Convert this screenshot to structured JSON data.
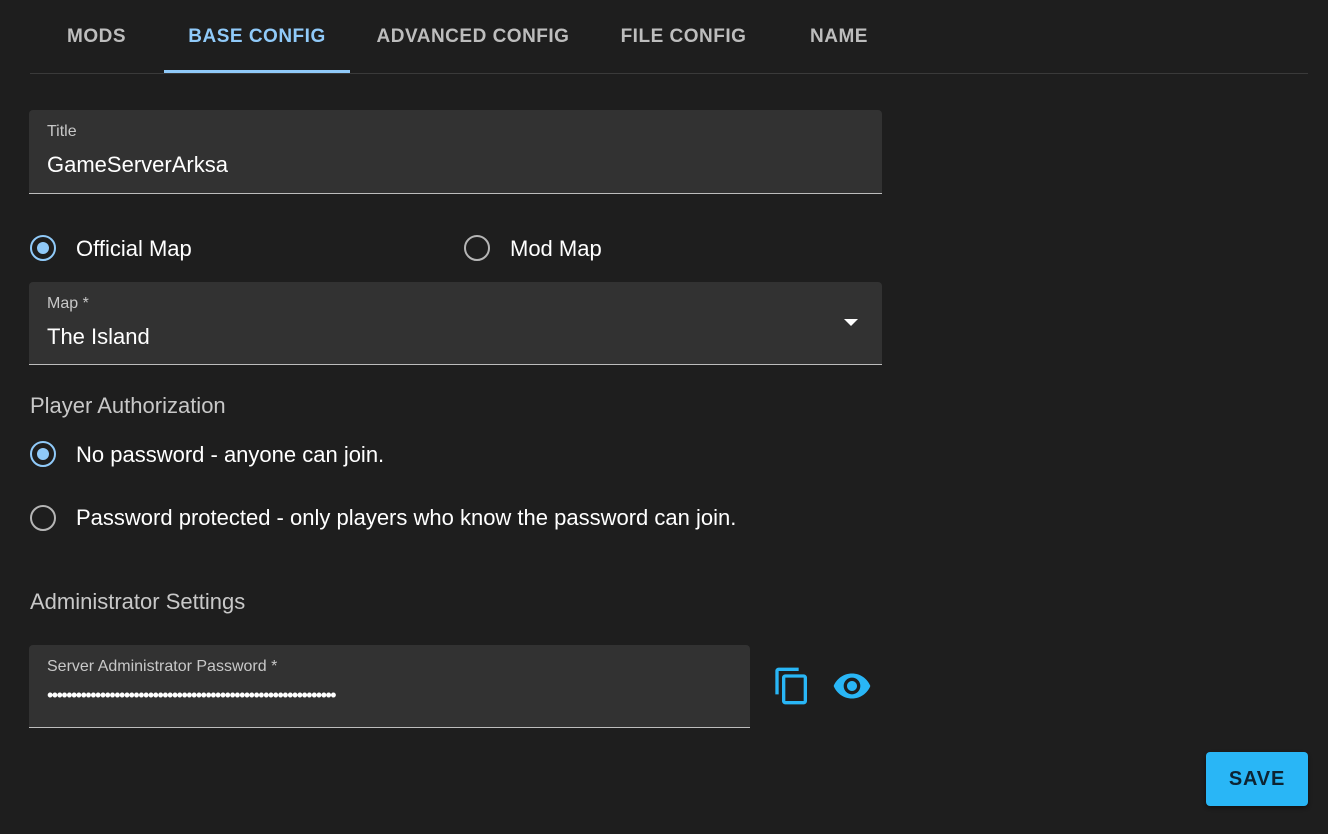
{
  "tabs": [
    {
      "label": "MODS",
      "active": false
    },
    {
      "label": "BASE CONFIG",
      "active": true
    },
    {
      "label": "ADVANCED CONFIG",
      "active": false
    },
    {
      "label": "FILE CONFIG",
      "active": false
    },
    {
      "label": "NAME",
      "active": false
    }
  ],
  "title_field": {
    "label": "Title",
    "value": "GameServerArksa"
  },
  "map_type": {
    "options": [
      {
        "label": "Official Map",
        "checked": true
      },
      {
        "label": "Mod Map",
        "checked": false
      }
    ]
  },
  "map_select": {
    "label": "Map *",
    "value": "The Island"
  },
  "player_auth": {
    "heading": "Player Authorization",
    "options": [
      {
        "label": "No password - anyone can join.",
        "checked": true
      },
      {
        "label": "Password protected - only players who know the password can join.",
        "checked": false
      }
    ]
  },
  "admin": {
    "heading": "Administrator Settings",
    "password_label": "Server Administrator Password *",
    "password_value": "••••••••••••••••••••••••••••••••••••••••••••••••••••••••••••",
    "icons": [
      "copy-icon",
      "eye-icon"
    ]
  },
  "save_label": "SAVE",
  "colors": {
    "background": "#1e1e1e",
    "field_bg": "#323232",
    "accent": "#90caf9",
    "icon_blue": "#29b6f6",
    "save_bg": "#29b6f6"
  }
}
